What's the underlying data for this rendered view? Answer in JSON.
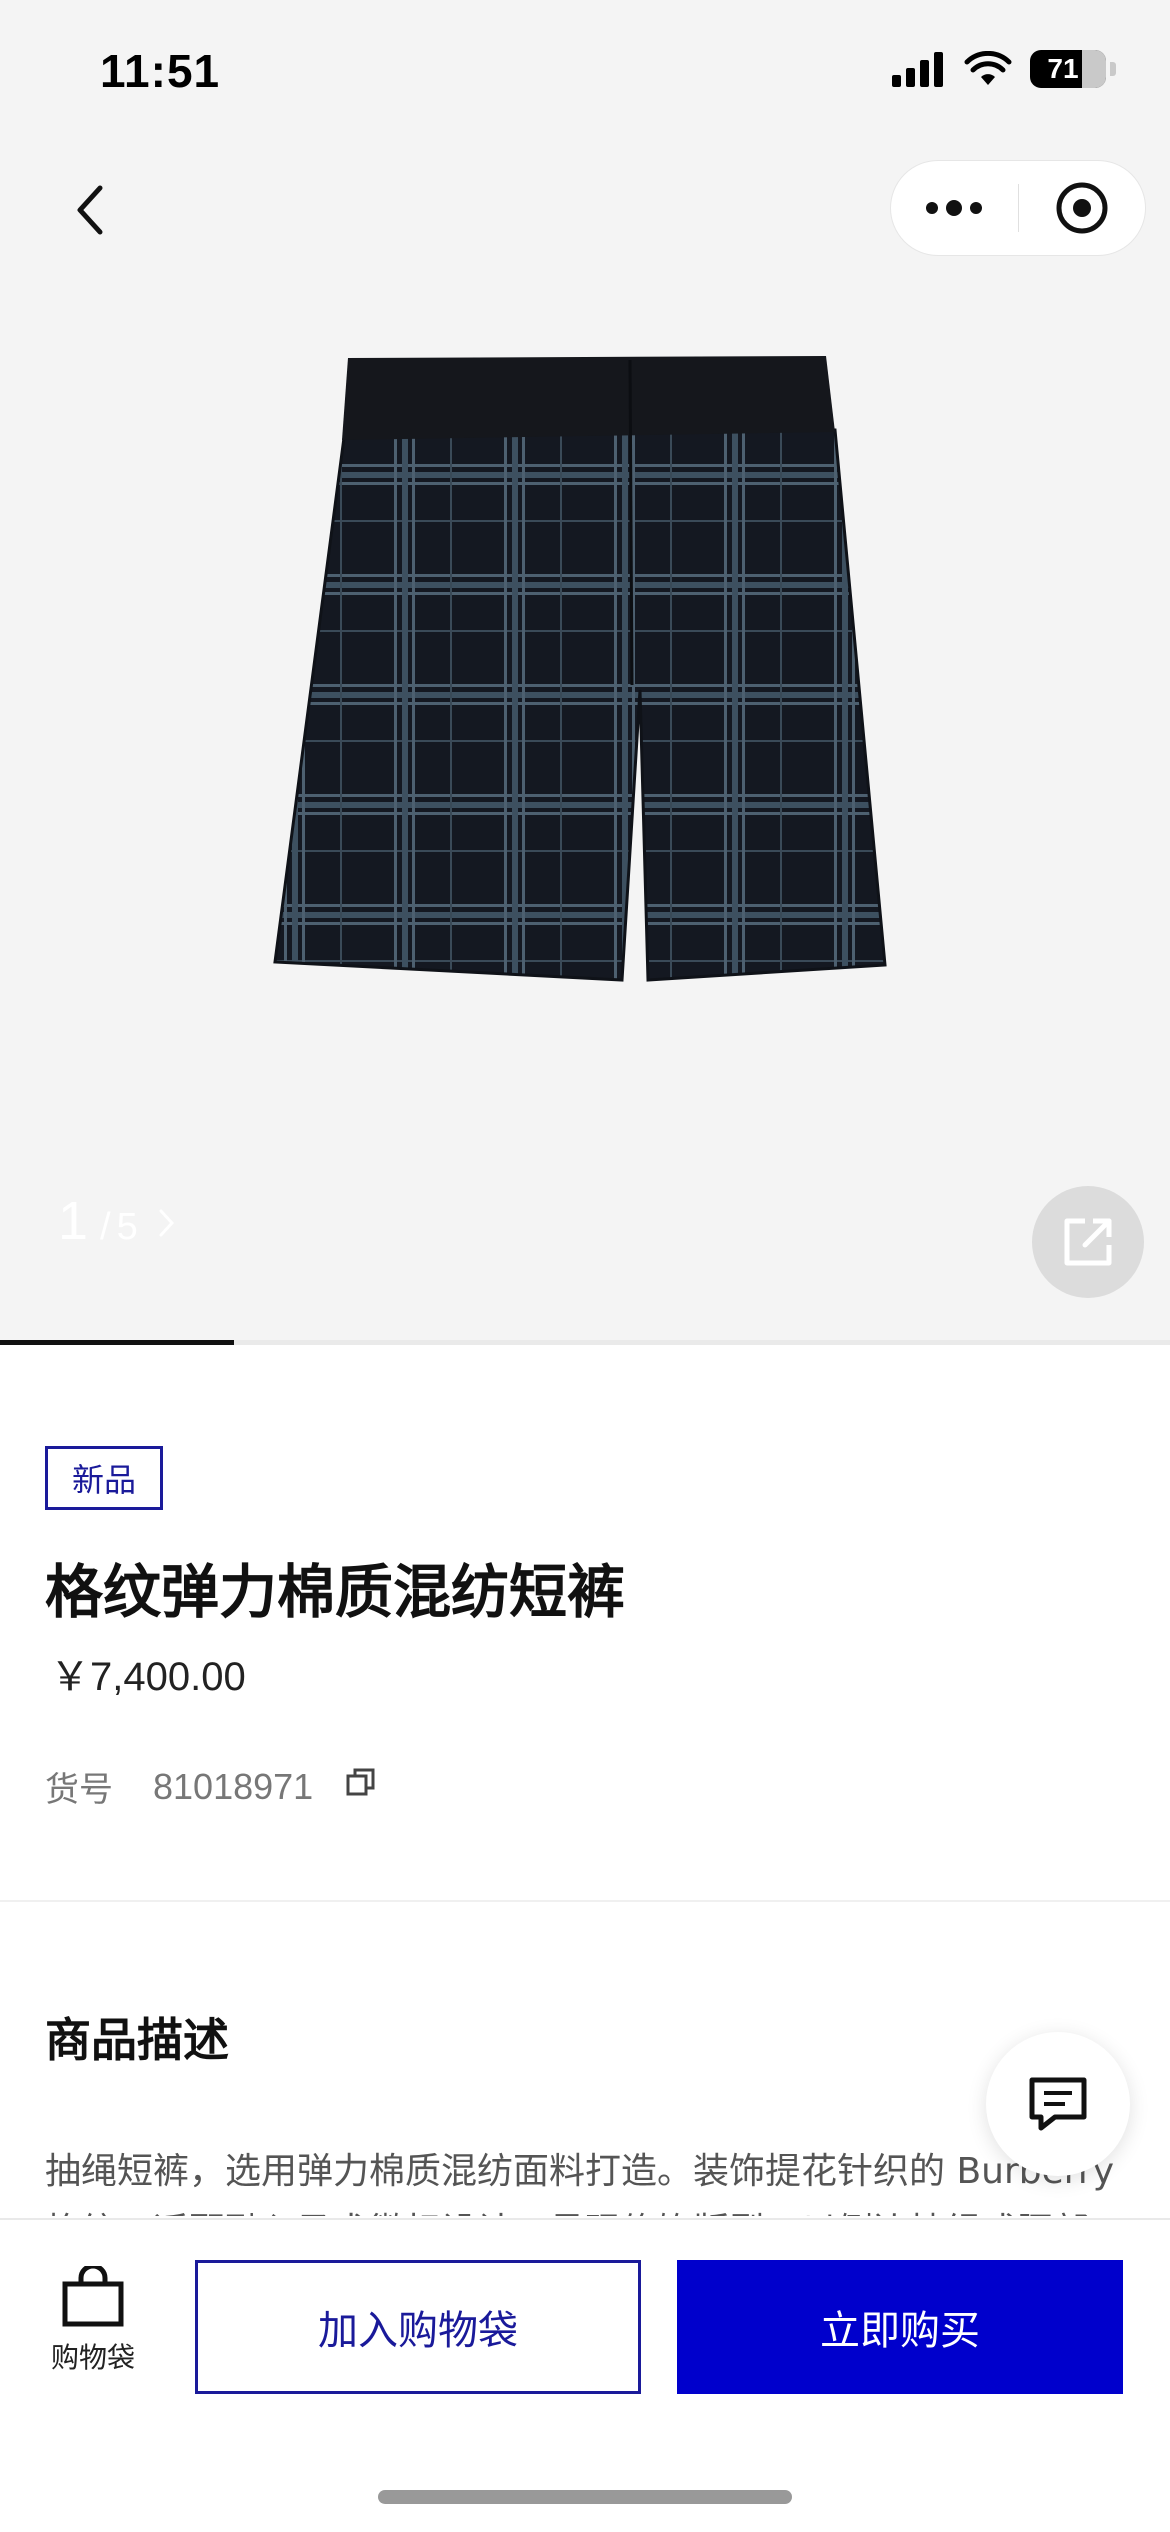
{
  "status_bar": {
    "time": "11:51",
    "battery": "71"
  },
  "gallery": {
    "current": "1",
    "separator": "/",
    "total": "5",
    "progress": 0.2
  },
  "product": {
    "badge": "新品",
    "title": "格纹弹力棉质混纺短裤",
    "price": "￥7,400.00",
    "sku_label": "货号",
    "sku_value": "81018971"
  },
  "description": {
    "heading": "商品描述",
    "text": "抽绳短裤，选用弹力棉质混纺面料打造。装饰提花针织的 Burberry 格纹，适配融入马术徽标设计，呈现修饰版型，以侧边抽绳式腰部"
  },
  "bottom_bar": {
    "bag_label": "购物袋",
    "add_to_bag": "加入购物袋",
    "buy_now": "立即购买"
  },
  "colors": {
    "accent": "#0000cc",
    "badge": "#1a1a9a"
  },
  "icons": [
    "chevron-left-icon",
    "more-icon",
    "target-icon",
    "share-icon",
    "copy-icon",
    "chat-icon",
    "bag-icon"
  ]
}
